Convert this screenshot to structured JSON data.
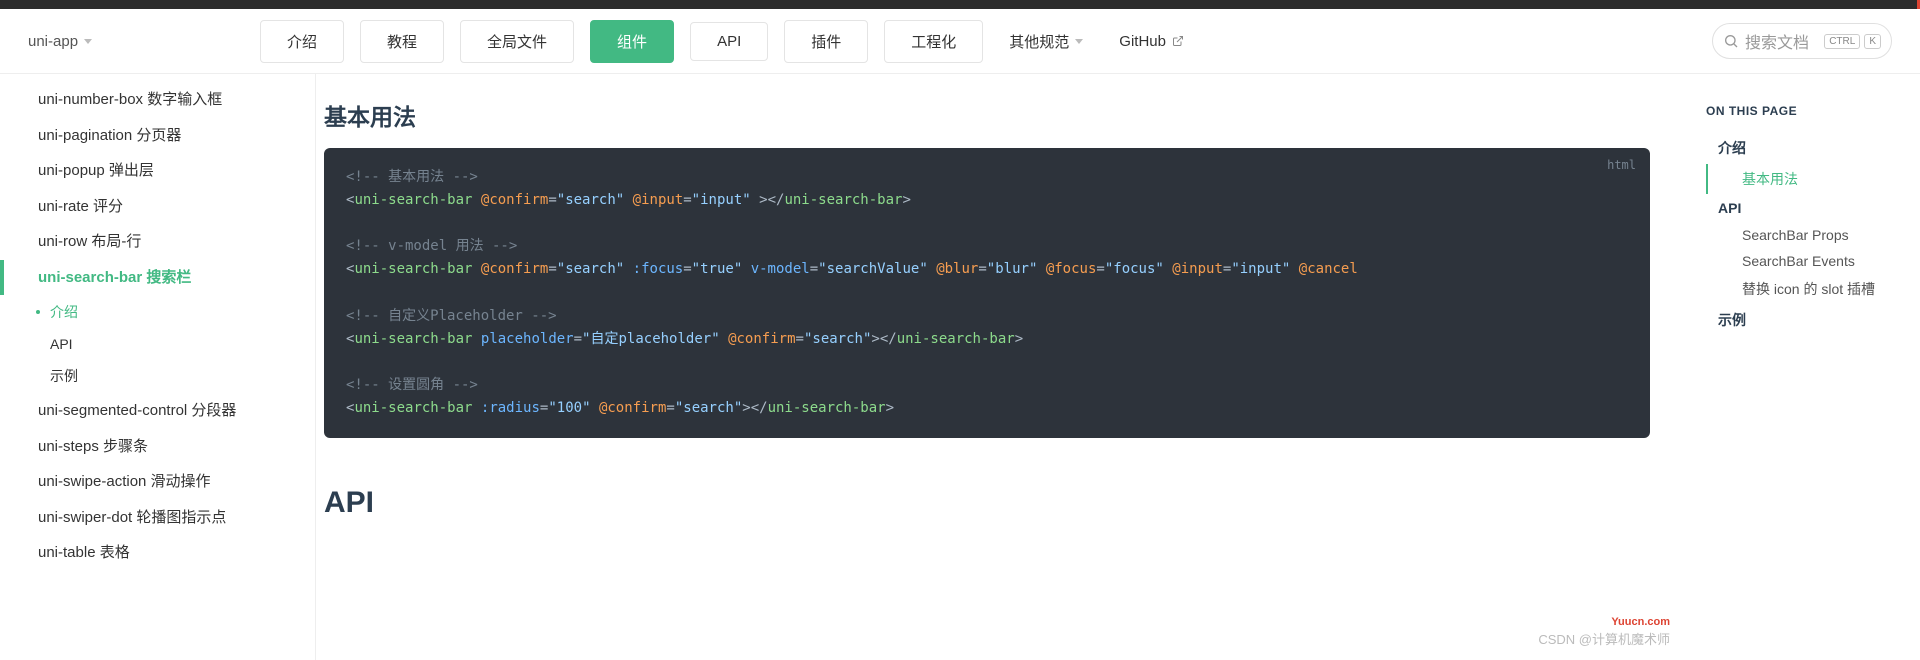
{
  "nav": {
    "brand": "uni-app",
    "items": [
      "介绍",
      "教程",
      "全局文件",
      "组件",
      "API",
      "插件",
      "工程化"
    ],
    "active_index": 3,
    "other": "其他规范",
    "github": "GitHub",
    "search_placeholder": "搜索文档",
    "kbd1": "CTRL",
    "kbd2": "K"
  },
  "sidebar": {
    "items": [
      {
        "label": "uni-number-box 数字输入框"
      },
      {
        "label": "uni-pagination 分页器"
      },
      {
        "label": "uni-popup 弹出层"
      },
      {
        "label": "uni-rate 评分"
      },
      {
        "label": "uni-row 布局-行"
      },
      {
        "label": "uni-search-bar 搜索栏",
        "active": true,
        "children": [
          {
            "label": "介绍",
            "active": true
          },
          {
            "label": "API"
          },
          {
            "label": "示例"
          }
        ]
      },
      {
        "label": "uni-segmented-control 分段器"
      },
      {
        "label": "uni-steps 步骤条"
      },
      {
        "label": "uni-swipe-action 滑动操作"
      },
      {
        "label": "uni-swiper-dot 轮播图指示点"
      },
      {
        "label": "uni-table 表格"
      }
    ]
  },
  "main": {
    "heading": "基本用法",
    "code_lang": "html",
    "api_heading": "API"
  },
  "code": {
    "c1": "<!-- 基本用法 -->",
    "l2_tag": "uni-search-bar",
    "l2_e1": "@confirm",
    "l2_v1": "search",
    "l2_e2": "@input",
    "l2_v2": "input",
    "c2": "<!-- v-model 用法 -->",
    "l4_tag": "uni-search-bar",
    "l4_e1": "@confirm",
    "l4_v1": "search",
    "l4_a1": ":focus",
    "l4_av1": "true",
    "l4_a2": "v-model",
    "l4_av2": "searchValue",
    "l4_e2": "@blur",
    "l4_v2": "blur",
    "l4_e3": "@focus",
    "l4_v3": "focus",
    "l4_e4": "@input",
    "l4_v4": "input",
    "l4_e5": "@cancel",
    "c3": "<!-- 自定义Placeholder -->",
    "l6_tag": "uni-search-bar",
    "l6_a1": "placeholder",
    "l6_av1": "自定placeholder",
    "l6_e1": "@confirm",
    "l6_v1": "search",
    "c4": "<!-- 设置圆角 -->",
    "l8_tag": "uni-search-bar",
    "l8_a1": ":radius",
    "l8_av1": "100",
    "l8_e1": "@confirm",
    "l8_v1": "search"
  },
  "toc": {
    "title": "ON THIS PAGE",
    "items": [
      {
        "label": "介绍",
        "type": "h"
      },
      {
        "label": "基本用法",
        "type": "i",
        "active": true
      },
      {
        "label": "API",
        "type": "h"
      },
      {
        "label": "SearchBar Props",
        "type": "i"
      },
      {
        "label": "SearchBar Events",
        "type": "i"
      },
      {
        "label": "替换 icon 的 slot 插槽",
        "type": "i"
      },
      {
        "label": "示例",
        "type": "h"
      }
    ]
  },
  "watermark": "CSDN @计算机魔术师",
  "watermark2": "Yuucn.com"
}
